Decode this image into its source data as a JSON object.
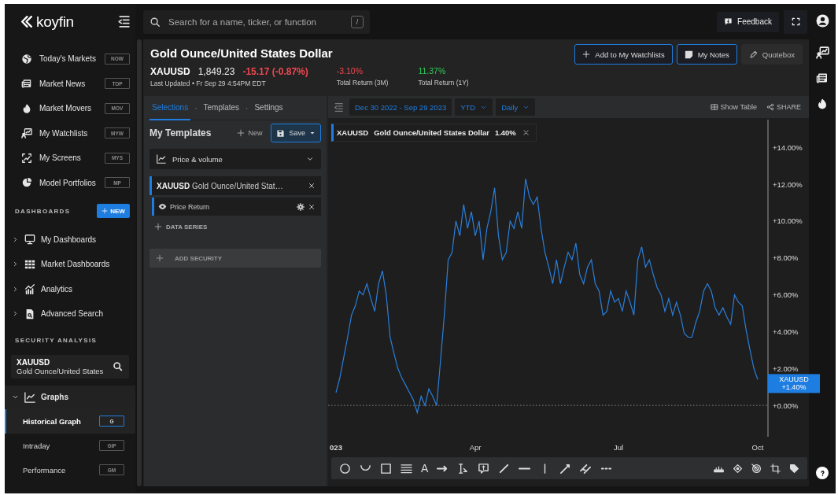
{
  "app": {
    "logo": "koyfin"
  },
  "search": {
    "placeholder": "Search for a name, ticker, or function",
    "shortcut": "/"
  },
  "top_actions": {
    "feedback": "Feedback"
  },
  "sidebar": {
    "items": [
      {
        "label": "Today's Markets",
        "shortcut": "NOW"
      },
      {
        "label": "Market News",
        "shortcut": "TOP"
      },
      {
        "label": "Market Movers",
        "shortcut": "MOV"
      },
      {
        "label": "My Watchlists",
        "shortcut": "MYW"
      },
      {
        "label": "My Screens",
        "shortcut": "MYS"
      },
      {
        "label": "Model Portfolios",
        "shortcut": "MP"
      }
    ],
    "dashboards": {
      "title": "DASHBOARDS",
      "new_button": "NEW",
      "items": [
        {
          "label": "My Dashboards",
          "expanded": false
        },
        {
          "label": "Market Dashboards",
          "expanded": false
        },
        {
          "label": "Analytics",
          "expanded": false
        },
        {
          "label": "Advanced Search",
          "expanded": false
        }
      ]
    },
    "security_analysis": {
      "title": "SECURITY ANALYSIS",
      "ticker": "XAUUSD",
      "name": "Gold Ounce/United States",
      "group": {
        "label": "Graphs",
        "expanded": true,
        "items": [
          {
            "label": "Historical Graph",
            "shortcut": "G",
            "selected": true
          },
          {
            "label": "Intraday",
            "shortcut": "GIP",
            "selected": false
          },
          {
            "label": "Performance",
            "shortcut": "GM",
            "selected": false
          }
        ]
      }
    }
  },
  "header": {
    "title": "Gold Ounce/United States Dollar",
    "ticker": "XAUUSD",
    "price": "1,849.23",
    "change": "-15.17",
    "change_pct": "(-0.87%)",
    "updated": "Last Updated • Fr Sep 29 4:54PM EDT",
    "stats": [
      {
        "value": "-3.10%",
        "label": "Total Return (3M)",
        "color": "#f0474f"
      },
      {
        "value": "11.37%",
        "label": "Total Return (1Y)",
        "color": "#2ecc5a"
      }
    ],
    "buttons": [
      {
        "label": "Add to My Watchlists",
        "kind": "add"
      },
      {
        "label": "My Notes",
        "kind": "notes"
      },
      {
        "label": "Quotebox",
        "kind": "quotebox"
      }
    ]
  },
  "panel": {
    "tabs": [
      {
        "label": "Selections",
        "selected": true
      },
      {
        "label": "Templates",
        "selected": false
      },
      {
        "label": "Settings",
        "selected": false
      }
    ],
    "tab_separator": "·",
    "templates_title": "My Templates",
    "new_button": "New",
    "save_button": "Save",
    "template": "Price & volume",
    "security": {
      "ticker": "XAUUSD",
      "name": "Gold Ounce/United Stat…"
    },
    "series": [
      {
        "label": "Price Return"
      }
    ],
    "add_series": "DATA SERIES",
    "add_security": "ADD SECURITY"
  },
  "chart": {
    "range": "Dec 30 2022 - Sep 29 2023",
    "period": "YTD",
    "interval": "Daily",
    "show_table": "Show Table",
    "share": "SHARE",
    "legend": {
      "name": "Gold Ounce/United States Dollar",
      "value": "1.40%"
    },
    "price_tag": {
      "ticker": "XAUUSD",
      "value": "+1.40%"
    },
    "text_tool": "A",
    "chart_data": {
      "type": "line",
      "categories": [
        "023",
        null,
        null,
        null,
        null,
        null,
        null,
        null,
        null,
        null,
        null,
        null,
        null,
        null,
        null,
        null,
        null,
        null,
        null,
        null,
        null,
        null,
        null,
        null,
        null,
        null,
        null,
        null,
        null,
        null,
        null,
        null,
        null,
        null,
        null,
        null,
        "Apr",
        null,
        null,
        null,
        null,
        null,
        null,
        null,
        null,
        null,
        null,
        null,
        null,
        null,
        null,
        null,
        null,
        null,
        null,
        null,
        null,
        null,
        null,
        null,
        null,
        null,
        null,
        null,
        null,
        null,
        null,
        null,
        null,
        null,
        null,
        null,
        null,
        "Jul",
        null,
        null,
        null,
        null,
        null,
        null,
        null,
        null,
        null,
        null,
        null,
        null,
        null,
        null,
        null,
        null,
        null,
        null,
        null,
        null,
        null,
        null,
        null,
        null,
        null,
        null,
        null,
        null,
        null,
        null,
        null,
        null,
        null,
        null,
        null,
        "Oct"
      ],
      "series": [
        {
          "name": "XAUUSD",
          "color": "#2a7fdc",
          "values": [
            0.7,
            1.5,
            2.6,
            3.7,
            4.9,
            5.4,
            6.2,
            6.0,
            6.6,
            5.8,
            5.1,
            6.6,
            7.3,
            6.0,
            3.7,
            2.8,
            2.0,
            1.5,
            1.1,
            0.7,
            0.3,
            -0.4,
            0.5,
            0.0,
            0.9,
            0.5,
            0.0,
            2.4,
            4.9,
            7.9,
            8.3,
            10.0,
            9.2,
            10.9,
            9.6,
            10.5,
            9.2,
            10.0,
            7.9,
            9.6,
            10.5,
            11.8,
            9.2,
            7.9,
            8.3,
            10.0,
            9.6,
            10.5,
            9.6,
            12.3,
            11.3,
            10.9,
            11.3,
            9.6,
            8.3,
            7.5,
            6.6,
            7.9,
            6.6,
            7.5,
            8.3,
            7.9,
            8.8,
            7.1,
            6.6,
            7.5,
            7.9,
            6.6,
            6.2,
            4.9,
            5.1,
            6.2,
            5.6,
            5.8,
            5.1,
            6.2,
            5.6,
            4.9,
            7.9,
            8.6,
            7.5,
            7.9,
            7.1,
            6.4,
            6.0,
            5.1,
            5.8,
            4.9,
            5.6,
            4.9,
            3.9,
            3.7,
            3.7,
            4.5,
            5.1,
            6.2,
            6.6,
            6.2,
            5.3,
            4.9,
            5.3,
            4.8,
            4.4,
            6.0,
            5.6,
            5.4,
            4.1,
            3.0,
            2.0,
            1.4
          ]
        }
      ],
      "ylim": [
        -1.7,
        15.5
      ],
      "yticks": [
        {
          "value": 0,
          "label": "+0.00%"
        },
        {
          "value": 2,
          "label": "+2.00%"
        },
        {
          "value": 4,
          "label": "+4.00%"
        },
        {
          "value": 6,
          "label": "+6.00%"
        },
        {
          "value": 8,
          "label": "+8.00%"
        },
        {
          "value": 10,
          "label": "+10.00%"
        },
        {
          "value": 12,
          "label": "+12.00%"
        },
        {
          "value": 14,
          "label": "+14.00%"
        }
      ]
    }
  }
}
